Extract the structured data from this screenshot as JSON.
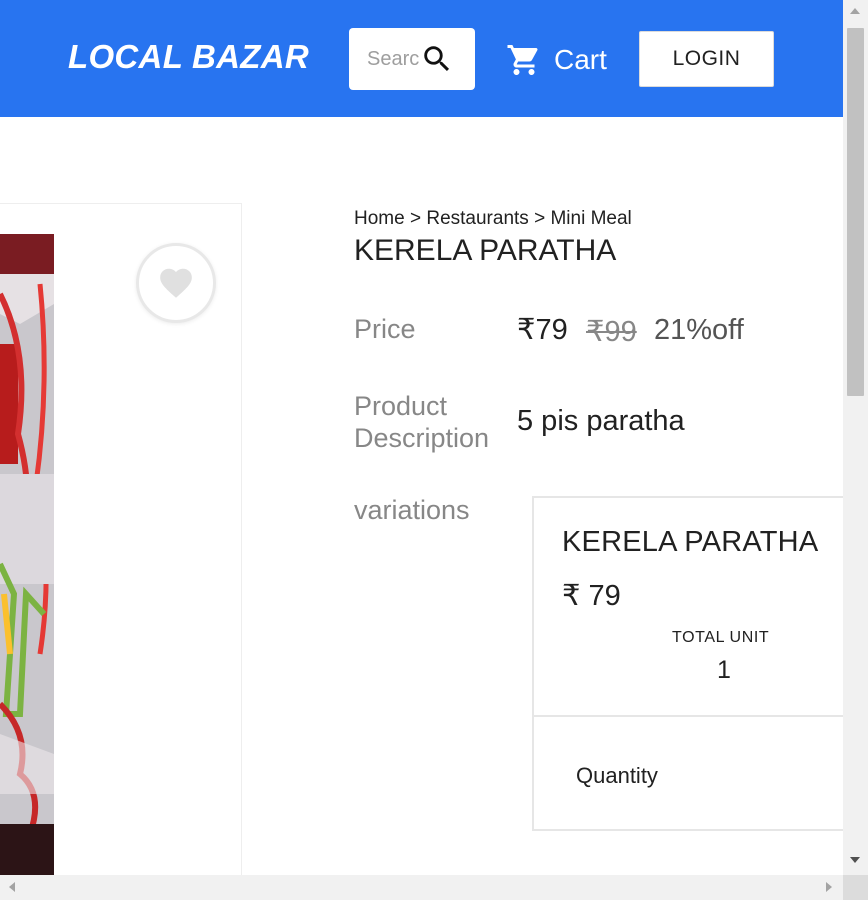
{
  "header": {
    "logo": "LOCAL BAZAR",
    "search_placeholder": "Search",
    "cart_label": "Cart",
    "login_label": "LOGIN",
    "bg_color": "#2874f0",
    "icons": {
      "search": "search-icon",
      "cart": "cart-icon"
    }
  },
  "breadcrumb": {
    "items": [
      "Home",
      "Restaurants",
      "Mini Meal"
    ],
    "separator": ">"
  },
  "product": {
    "title": "KERELA PARATHA",
    "price_label": "Price",
    "price": "₹79",
    "mrp": "₹99",
    "discount": "21%off",
    "description_label": "Product Description",
    "description": "5 pis paratha",
    "variations_label": "variations",
    "wishlist_icon": "heart-icon"
  },
  "variation": {
    "name": "KERELA PARATHA",
    "price": "₹ 79",
    "total_unit_label": "TOTAL UNIT",
    "total_unit": "1",
    "quantity_label": "Quantity"
  }
}
